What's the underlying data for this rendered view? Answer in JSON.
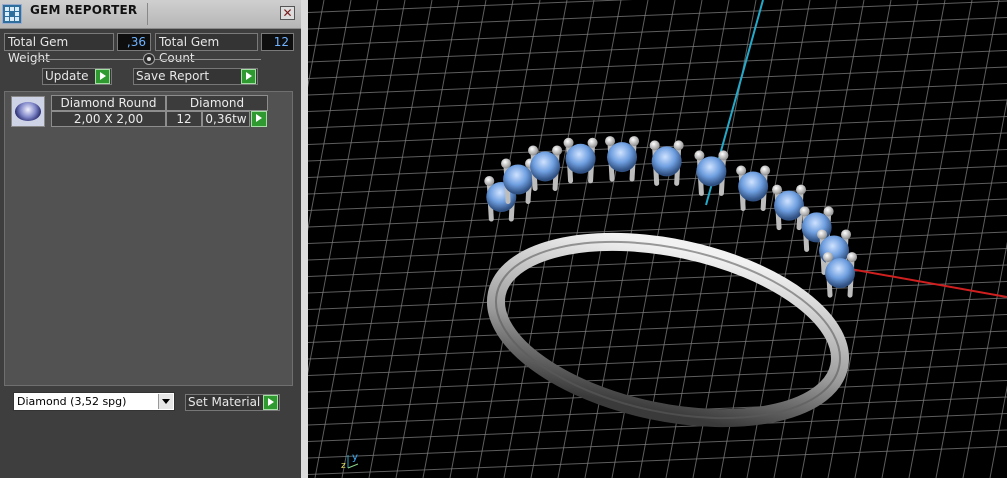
{
  "window": {
    "title": "GEM REPORTER",
    "close_glyph": "✕"
  },
  "totals": {
    "weight_label": "Total Gem Weight",
    "weight_value": ",36",
    "count_label": "Total Gem Count",
    "count_value": "12"
  },
  "buttons": {
    "update": "Update",
    "save_report": "Save Report",
    "set_material": "Set Material"
  },
  "gem_list": {
    "rows": [
      {
        "shape": "Diamond Round",
        "material": "Diamond",
        "size": "2,00 X 2,00",
        "count": "12",
        "weight": "0,36tw"
      }
    ]
  },
  "material_select": {
    "value": "Diamond     (3,52 spg)"
  },
  "viewport": {
    "axis_label_y": "y",
    "axis_label_z": "z",
    "colors": {
      "grid": "#7c7c7c",
      "axis_x": "#d01f1f",
      "axis_y": "#25a9c9",
      "gem": "#79a9e6",
      "metal": "#c8c8c8"
    },
    "icons": [
      "axis-gizmo-icon",
      "ring-model"
    ]
  }
}
